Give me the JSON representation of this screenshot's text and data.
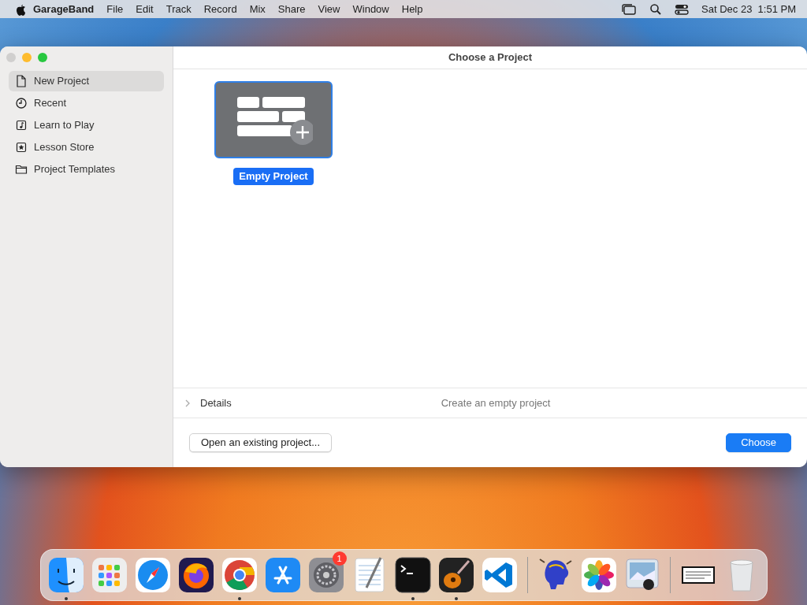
{
  "menubar": {
    "app": "GarageBand",
    "menus": [
      "File",
      "Edit",
      "Track",
      "Record",
      "Mix",
      "Share",
      "View",
      "Window",
      "Help"
    ],
    "clock": "Sat Dec 23  1:51 PM"
  },
  "window": {
    "title": "Choose a Project",
    "sidebar": [
      {
        "label": "New Project",
        "kind": "document",
        "selected": true
      },
      {
        "label": "Recent",
        "kind": "clock",
        "selected": false
      },
      {
        "label": "Learn to Play",
        "kind": "note",
        "selected": false
      },
      {
        "label": "Lesson Store",
        "kind": "star",
        "selected": false
      },
      {
        "label": "Project Templates",
        "kind": "folder",
        "selected": false
      }
    ],
    "projects": [
      {
        "label": "Empty Project",
        "selected": true
      }
    ],
    "details": {
      "label": "Details",
      "expanded": false,
      "description": "Create an empty project"
    },
    "open_button": "Open an existing project...",
    "choose_button": "Choose"
  },
  "dock": [
    {
      "kind": "finder",
      "running": true
    },
    {
      "kind": "launchpad",
      "running": false
    },
    {
      "kind": "safari",
      "running": false
    },
    {
      "kind": "firefox",
      "running": false
    },
    {
      "kind": "chrome",
      "running": true
    },
    {
      "kind": "appstore",
      "running": false
    },
    {
      "kind": "settings",
      "running": false,
      "badge": "1"
    },
    {
      "kind": "textedit",
      "running": false
    },
    {
      "kind": "terminal",
      "running": true
    },
    {
      "kind": "guitar",
      "running": true
    },
    {
      "kind": "vscode",
      "running": false
    },
    {
      "kind": "separator"
    },
    {
      "kind": "brain",
      "running": false
    },
    {
      "kind": "photos",
      "running": false
    },
    {
      "kind": "preview",
      "running": false
    },
    {
      "kind": "separator"
    },
    {
      "kind": "document",
      "running": false
    },
    {
      "kind": "trash",
      "running": false
    }
  ]
}
